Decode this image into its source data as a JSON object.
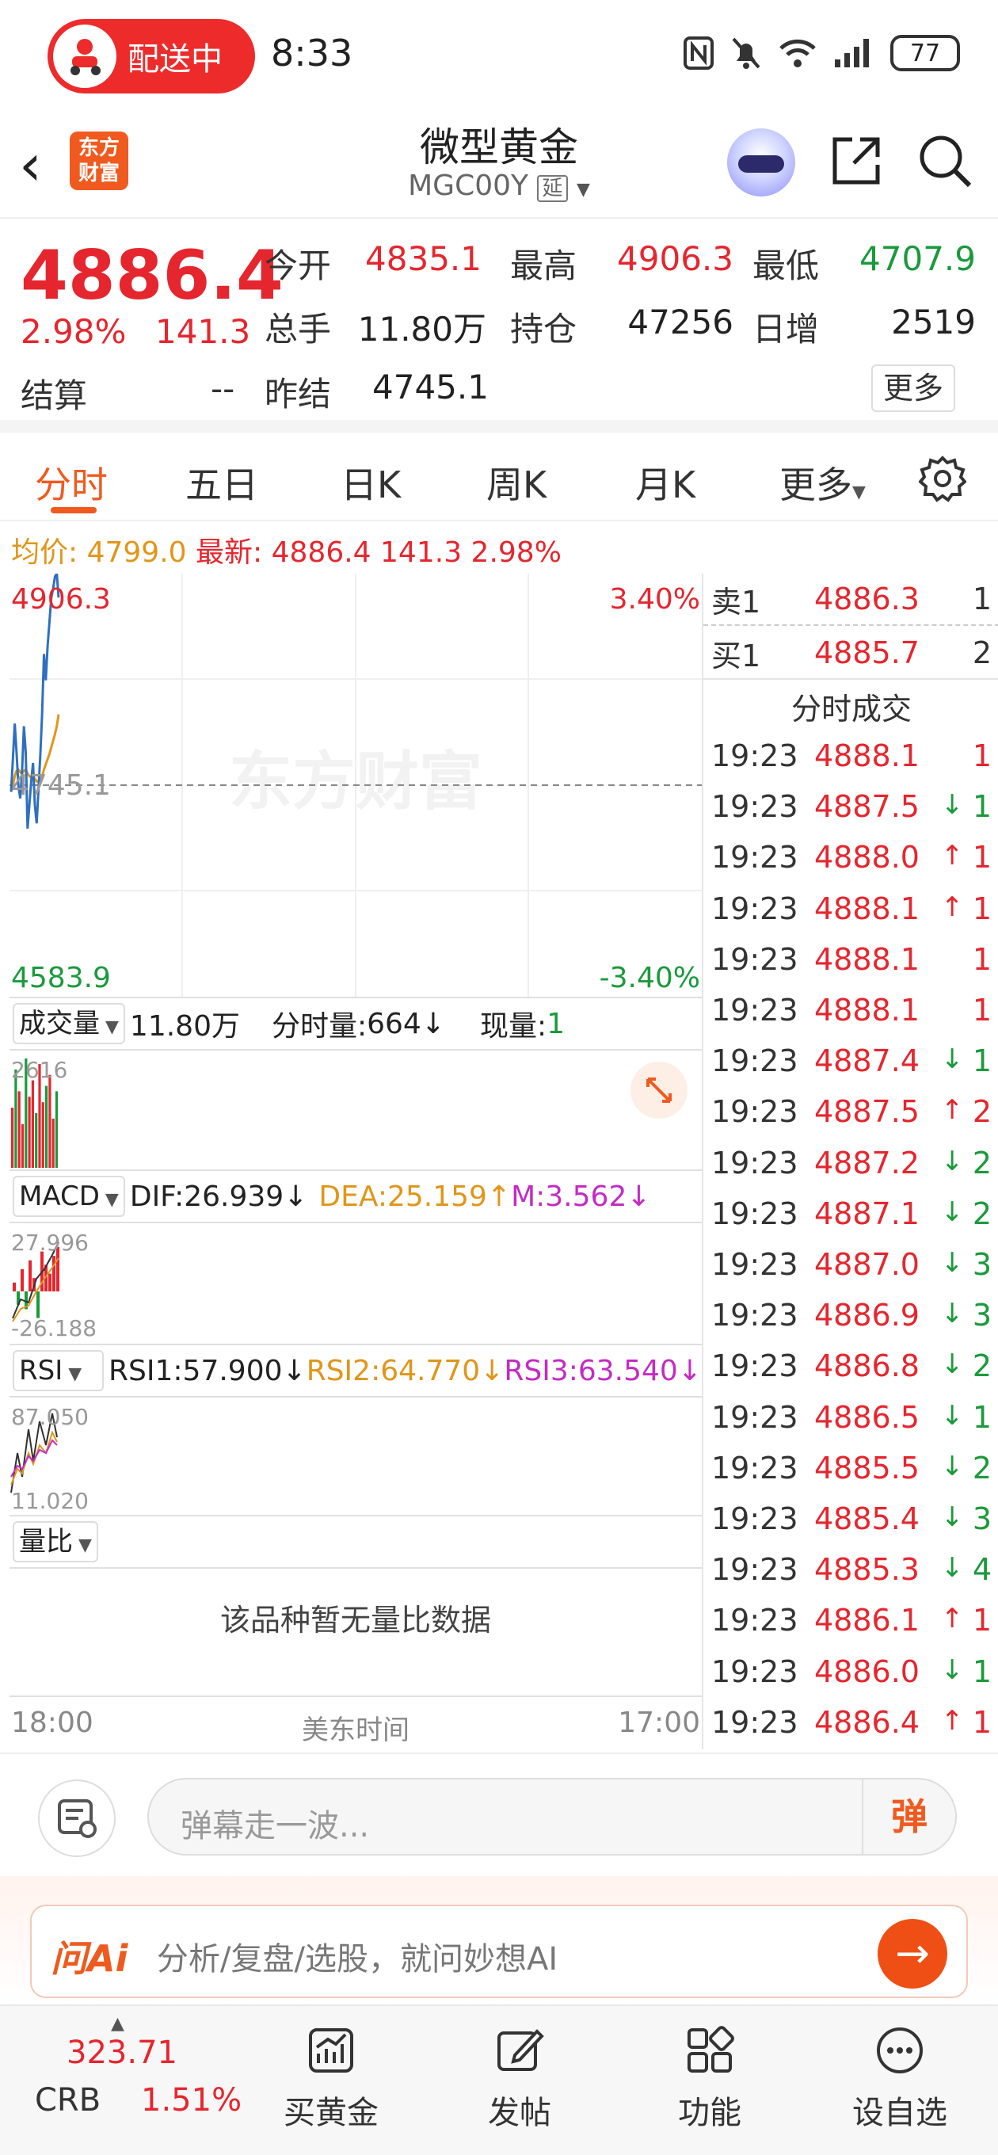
{
  "status_bar": {
    "delivery_label": "配送中",
    "time": "8:33",
    "battery": "77"
  },
  "header": {
    "logo_text": "东方财富",
    "title": "微型黄金",
    "code": "MGC00Y",
    "delay_badge": "延"
  },
  "quote": {
    "price": "4886.4",
    "change_pct": "2.98%",
    "change": "141.3",
    "settle_label": "结算",
    "settle_value": "--",
    "open_label": "今开",
    "open_value": "4835.1",
    "high_label": "最高",
    "high_value": "4906.3",
    "low_label": "最低",
    "low_value": "4707.9",
    "volume_label": "总手",
    "volume_value": "11.80万",
    "oi_label": "持仓",
    "oi_value": "47256",
    "daily_inc_label": "日增",
    "daily_inc_value": "2519",
    "prev_settle_label": "昨结",
    "prev_settle_value": "4745.1",
    "more_label": "更多"
  },
  "tabs": [
    "分时",
    "五日",
    "日K",
    "周K",
    "月K",
    "更多"
  ],
  "info_line": {
    "avg_label": "均价:",
    "avg_value": "4799.0",
    "latest_label": "最新:",
    "latest_value": "4886.4",
    "change": "141.3",
    "change_pct": "2.98%"
  },
  "chart_data": {
    "type": "line",
    "watermark": "东方财富",
    "y_max_label": "4906.3",
    "y_mid_label": "4745.1",
    "y_min_label": "4583.9",
    "pct_max_label": "3.40%",
    "pct_min_label": "-3.40%",
    "x_start_label": "18:00",
    "x_mid_label": "美东时间",
    "x_end_label": "17:00",
    "ylim": [
      4583.9,
      4906.3
    ],
    "series": [
      {
        "values": [
          4740,
          4765,
          4792,
          4770,
          4745,
          4735,
          4755,
          4790,
          4770,
          4712,
          4730,
          4748,
          4762,
          4730,
          4716,
          4742,
          4768,
          4800,
          4845,
          4825,
          4852,
          4870,
          4888,
          4895,
          4904,
          4906.3,
          4888
        ]
      },
      {
        "values": [
          4740,
          4745,
          4752,
          4756,
          4757,
          4755,
          4754,
          4756,
          4757,
          4754,
          4752,
          4751,
          4752,
          4750,
          4748,
          4748,
          4749,
          4752,
          4757,
          4761,
          4765,
          4769,
          4774,
          4779,
          4784,
          4790,
          4799
        ]
      }
    ]
  },
  "volume_panel": {
    "selector": "成交量",
    "total": "11.80万",
    "minute_vol_label": "分时量:",
    "minute_vol_value": "664",
    "current_label": "现量:",
    "current_value": "1",
    "axis_label": "2616"
  },
  "macd_panel": {
    "selector": "MACD",
    "dif": "DIF:26.939",
    "dea": "DEA:25.159",
    "m": "M:3.562",
    "axis_top": "27.996",
    "axis_bottom": "-26.188"
  },
  "rsi_panel": {
    "selector": "RSI",
    "rsi1": "RSI1:57.900",
    "rsi2": "RSI2:64.770",
    "rsi3": "RSI3:63.540",
    "axis_top": "87.050",
    "axis_bottom": "11.020"
  },
  "ratio_panel": {
    "selector": "量比",
    "empty_text": "该品种暂无量比数据"
  },
  "order_book": {
    "sell": {
      "label": "卖1",
      "price": "4886.3",
      "qty": "1"
    },
    "buy": {
      "label": "买1",
      "price": "4885.7",
      "qty": "2"
    }
  },
  "trades_header": "分时成交",
  "trades": [
    {
      "time": "19:23",
      "price": "4888.1",
      "dir": "",
      "qty": "1",
      "qty_color": "red"
    },
    {
      "time": "19:23",
      "price": "4887.5",
      "dir": "down",
      "qty": "1",
      "qty_color": "green"
    },
    {
      "time": "19:23",
      "price": "4888.0",
      "dir": "up",
      "qty": "1",
      "qty_color": "red"
    },
    {
      "time": "19:23",
      "price": "4888.1",
      "dir": "up",
      "qty": "1",
      "qty_color": "red"
    },
    {
      "time": "19:23",
      "price": "4888.1",
      "dir": "",
      "qty": "1",
      "qty_color": "red"
    },
    {
      "time": "19:23",
      "price": "4888.1",
      "dir": "",
      "qty": "1",
      "qty_color": "red"
    },
    {
      "time": "19:23",
      "price": "4887.4",
      "dir": "down",
      "qty": "1",
      "qty_color": "green"
    },
    {
      "time": "19:23",
      "price": "4887.5",
      "dir": "up",
      "qty": "2",
      "qty_color": "red"
    },
    {
      "time": "19:23",
      "price": "4887.2",
      "dir": "down",
      "qty": "2",
      "qty_color": "green"
    },
    {
      "time": "19:23",
      "price": "4887.1",
      "dir": "down",
      "qty": "2",
      "qty_color": "green"
    },
    {
      "time": "19:23",
      "price": "4887.0",
      "dir": "down",
      "qty": "3",
      "qty_color": "green"
    },
    {
      "time": "19:23",
      "price": "4886.9",
      "dir": "down",
      "qty": "3",
      "qty_color": "green"
    },
    {
      "time": "19:23",
      "price": "4886.8",
      "dir": "down",
      "qty": "2",
      "qty_color": "green"
    },
    {
      "time": "19:23",
      "price": "4886.5",
      "dir": "down",
      "qty": "1",
      "qty_color": "green"
    },
    {
      "time": "19:23",
      "price": "4885.5",
      "dir": "down",
      "qty": "2",
      "qty_color": "green"
    },
    {
      "time": "19:23",
      "price": "4885.4",
      "dir": "down",
      "qty": "3",
      "qty_color": "green"
    },
    {
      "time": "19:23",
      "price": "4885.3",
      "dir": "down",
      "qty": "4",
      "qty_color": "green"
    },
    {
      "time": "19:23",
      "price": "4886.1",
      "dir": "up",
      "qty": "1",
      "qty_color": "red"
    },
    {
      "time": "19:23",
      "price": "4886.0",
      "dir": "down",
      "qty": "1",
      "qty_color": "green"
    },
    {
      "time": "19:23",
      "price": "4886.4",
      "dir": "up",
      "qty": "1",
      "qty_color": "red"
    }
  ],
  "comment_bar": {
    "placeholder": "弹幕走一波...",
    "danmu_label": "弹"
  },
  "ask_ai": {
    "brand": "问Ai",
    "text": "分析/复盘/选股，就问妙想AI"
  },
  "bottom_nav": {
    "ticker_value": "323.71",
    "ticker_name": "CRB",
    "ticker_pct": "1.51%",
    "items": [
      "买黄金",
      "发帖",
      "功能",
      "设自选"
    ]
  },
  "colors": {
    "up": "#e5262e",
    "down": "#1a9a3b",
    "accent": "#f05a1e",
    "avg_line": "#e0961a",
    "price_line": "#2f6fc1"
  }
}
